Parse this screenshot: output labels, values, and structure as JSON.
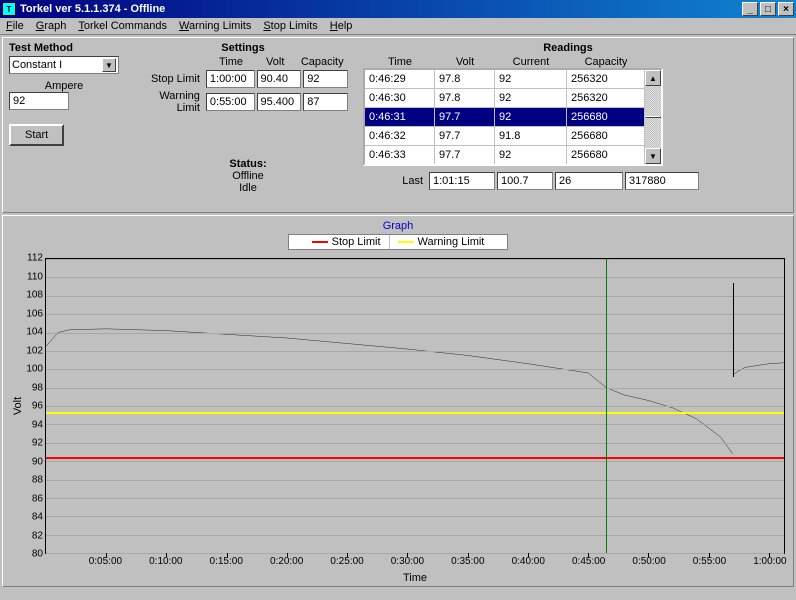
{
  "window": {
    "title": "Torkel ver 5.1.1.374 - Offline"
  },
  "menu": {
    "file": "File",
    "graph": "Graph",
    "torkel_commands": "Torkel Commands",
    "warning_limits": "Warning Limits",
    "stop_limits": "Stop Limits",
    "help": "Help"
  },
  "test_method": {
    "title": "Test Method",
    "selected": "Constant I",
    "ampere_label": "Ampere",
    "ampere_value": "92",
    "start_label": "Start"
  },
  "settings": {
    "title": "Settings",
    "col_time": "Time",
    "col_volt": "Volt",
    "col_capacity": "Capacity",
    "stop_limit_label": "Stop Limit",
    "warning_limit_label": "Warning Limit",
    "stop": {
      "time": "1:00:00",
      "volt": "90.40",
      "capacity": "92"
    },
    "warn": {
      "time": "0:55:00",
      "volt": "95.400",
      "capacity": "87"
    }
  },
  "status": {
    "title": "Status:",
    "line1": "Offline",
    "line2": "Idle"
  },
  "readings": {
    "title": "Readings",
    "col_time": "Time",
    "col_volt": "Volt",
    "col_current": "Current",
    "col_capacity": "Capacity",
    "rows": [
      {
        "time": "0:46:29",
        "volt": "97.8",
        "current": "92",
        "capacity": "256320"
      },
      {
        "time": "0:46:30",
        "volt": "97.8",
        "current": "92",
        "capacity": "256320"
      },
      {
        "time": "0:46:31",
        "volt": "97.7",
        "current": "92",
        "capacity": "256680"
      },
      {
        "time": "0:46:32",
        "volt": "97.7",
        "current": "91.8",
        "capacity": "256680"
      },
      {
        "time": "0:46:33",
        "volt": "97.7",
        "current": "92",
        "capacity": "256680"
      }
    ],
    "selected_index": 2,
    "last_label": "Last",
    "last": {
      "time": "1:01:15",
      "volt": "100.7",
      "current": "26",
      "capacity": "317880"
    }
  },
  "graph": {
    "title": "Graph",
    "legend_stop": "Stop Limit",
    "legend_warn": "Warning Limit",
    "ylabel": "Volt",
    "xlabel": "Time"
  },
  "chart_data": {
    "type": "line",
    "xlabel": "Time",
    "ylabel": "Volt",
    "ylim": [
      80,
      112
    ],
    "y_ticks": [
      80,
      82,
      84,
      86,
      88,
      90,
      92,
      94,
      96,
      98,
      100,
      102,
      104,
      106,
      108,
      110,
      112
    ],
    "x_ticks": [
      "0:05:00",
      "0:10:00",
      "0:15:00",
      "0:20:00",
      "0:25:00",
      "0:30:00",
      "0:35:00",
      "0:40:00",
      "0:45:00",
      "0:50:00",
      "0:55:00",
      "1:00:00"
    ],
    "x_minutes_range": [
      0,
      61.25
    ],
    "series": [
      {
        "name": "Volt",
        "color": "#000000",
        "x_min": [
          0,
          1,
          2,
          5,
          10,
          15,
          20,
          25,
          30,
          35,
          40,
          45,
          46.5,
          48,
          50,
          52,
          54,
          56,
          57,
          57.1,
          58,
          60,
          61.25
        ],
        "y": [
          102.5,
          104,
          104.3,
          104.4,
          104.2,
          103.8,
          103.4,
          102.8,
          102.2,
          101.5,
          100.6,
          99.6,
          98.0,
          97.2,
          96.6,
          95.8,
          94.6,
          92.6,
          90.8,
          99.5,
          100.2,
          100.6,
          100.7
        ]
      }
    ],
    "reference_lines": [
      {
        "name": "Stop Limit",
        "y": 90.4,
        "color": "#ff0000"
      },
      {
        "name": "Warning Limit",
        "y": 95.4,
        "color": "#ffff00"
      }
    ],
    "cursor_x_min": 46.5,
    "marker_x_min": 57
  }
}
